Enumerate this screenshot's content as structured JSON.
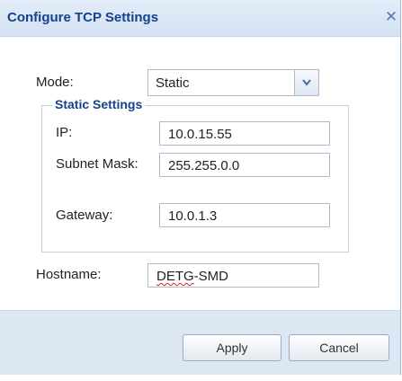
{
  "dialog": {
    "title": "Configure TCP Settings",
    "close_glyph": "✕"
  },
  "form": {
    "mode_label": "Mode:",
    "mode_value": "Static",
    "static_settings": {
      "legend": "Static Settings",
      "ip_label": "IP:",
      "ip_value": "10.0.15.55",
      "subnet_label": "Subnet Mask:",
      "subnet_value": "255.255.0.0",
      "gateway_label": "Gateway:",
      "gateway_value": "10.0.1.3"
    },
    "hostname_label": "Hostname:",
    "hostname_value_spellflagged": "DETG",
    "hostname_value_rest": "-SMD"
  },
  "footer": {
    "apply_label": "Apply",
    "cancel_label": "Cancel"
  },
  "colors": {
    "title_text": "#15428b",
    "titlebar_bg": "#d3e1f2",
    "footer_bg": "#dde7f4",
    "border": "#b5b8c8"
  },
  "icons": {
    "close": "close-icon",
    "dropdown": "chevron-down-icon"
  }
}
